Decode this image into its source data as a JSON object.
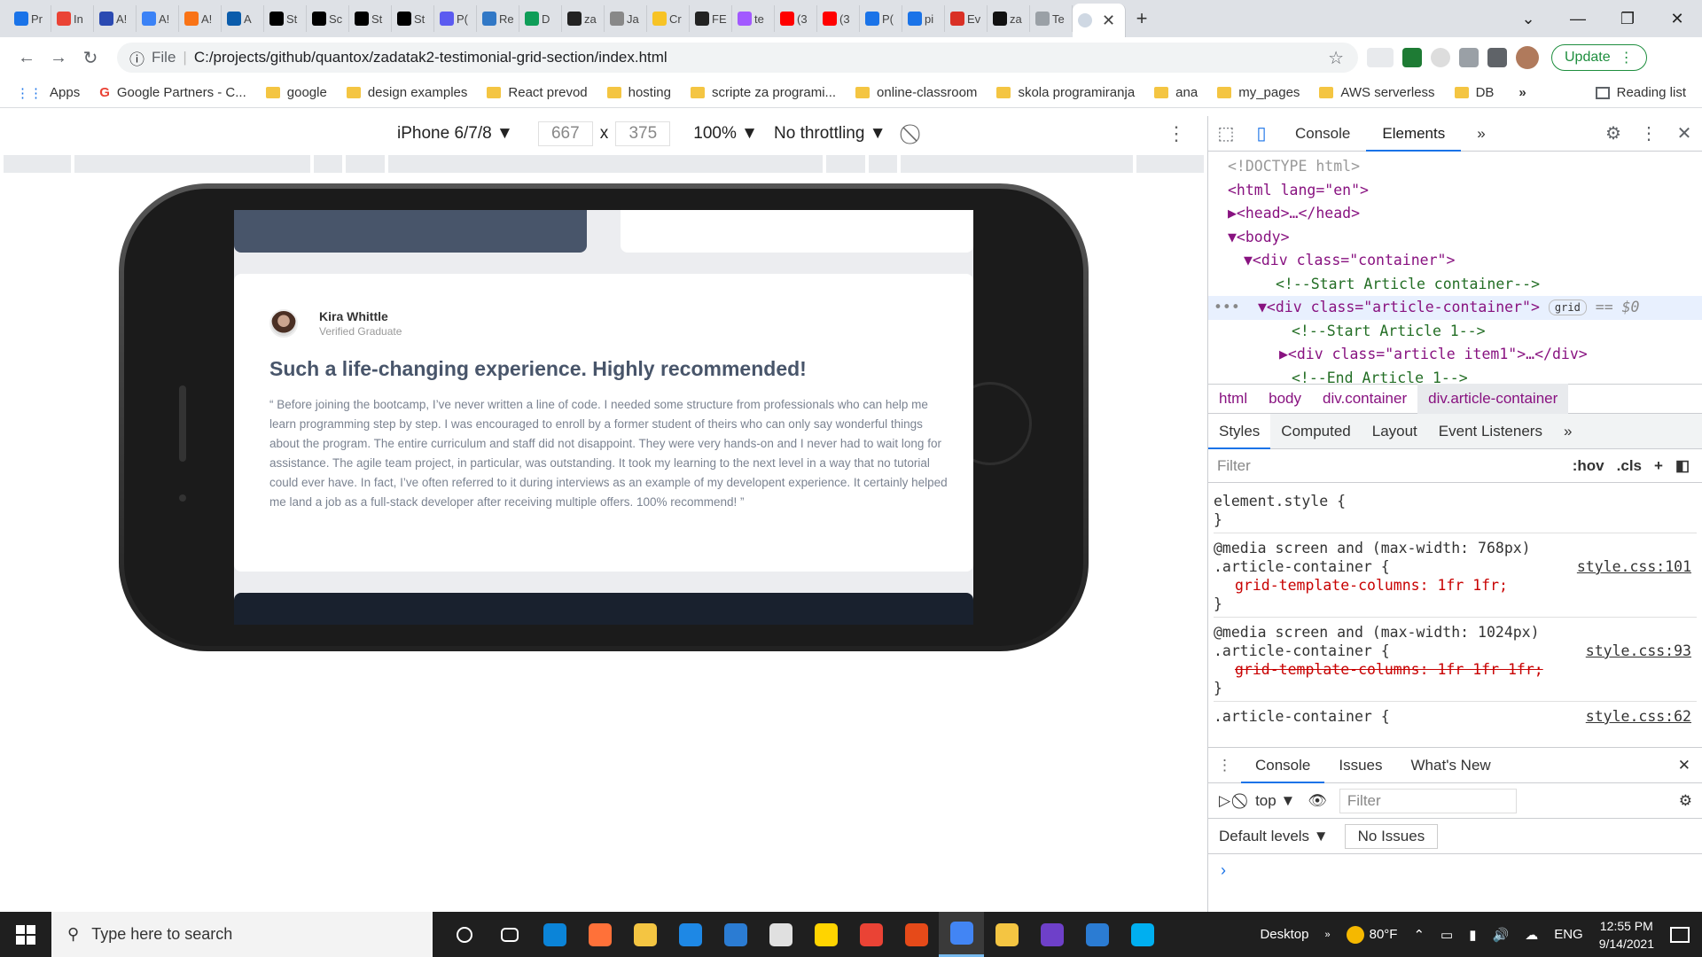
{
  "browser": {
    "tabs": [
      {
        "label": "Pr",
        "color": "#1a73e8"
      },
      {
        "label": "In",
        "color": "#ea4335"
      },
      {
        "label": "A!",
        "color": "#2b4ab2"
      },
      {
        "label": "A!",
        "color": "#3b82f6"
      },
      {
        "label": "A!",
        "color": "#f97316"
      },
      {
        "label": "A",
        "color": "#0b5cab"
      },
      {
        "label": "St",
        "color": "#000000"
      },
      {
        "label": "Sc",
        "color": "#000000"
      },
      {
        "label": "St",
        "color": "#000000"
      },
      {
        "label": "St",
        "color": "#000000"
      },
      {
        "label": "P(",
        "color": "#5b5bf0"
      },
      {
        "label": "Re",
        "color": "#3178c6"
      },
      {
        "label": "D",
        "color": "#0f9d58"
      },
      {
        "label": "za",
        "color": "#222222"
      },
      {
        "label": "Ja",
        "color": "#888888"
      },
      {
        "label": "Cr",
        "color": "#f7c325"
      },
      {
        "label": "FE",
        "color": "#222222"
      },
      {
        "label": "te",
        "color": "#a259ff"
      },
      {
        "label": "(3",
        "color": "#ff0000"
      },
      {
        "label": "(3",
        "color": "#ff0000"
      },
      {
        "label": "P(",
        "color": "#1a73e8"
      },
      {
        "label": "pi",
        "color": "#1a73e8"
      },
      {
        "label": "Ev",
        "color": "#d93025"
      },
      {
        "label": "za",
        "color": "#111111"
      },
      {
        "label": "Te",
        "color": "#9aa0a6"
      }
    ],
    "active_tab_icon": "globe-icon",
    "url_prefix": "File",
    "url": "C:/projects/github/quantox/zadatak2-testimonial-grid-section/index.html",
    "update_label": "Update"
  },
  "bookmarks": {
    "items": [
      {
        "label": "Apps",
        "kind": "apps"
      },
      {
        "label": "Google Partners - C...",
        "kind": "google"
      },
      {
        "label": "google",
        "kind": "folder"
      },
      {
        "label": "design examples",
        "kind": "folder"
      },
      {
        "label": "React prevod",
        "kind": "folder"
      },
      {
        "label": "hosting",
        "kind": "folder"
      },
      {
        "label": "scripte za programi...",
        "kind": "folder"
      },
      {
        "label": "online-classroom",
        "kind": "folder"
      },
      {
        "label": "skola programiranja",
        "kind": "folder"
      },
      {
        "label": "ana",
        "kind": "folder"
      },
      {
        "label": "my_pages",
        "kind": "folder"
      },
      {
        "label": "AWS serverless",
        "kind": "folder"
      },
      {
        "label": "DB",
        "kind": "folder"
      }
    ],
    "more": "»",
    "reading_list": "Reading list"
  },
  "device_toolbar": {
    "device": "iPhone 6/7/8",
    "width": "667",
    "height": "375",
    "zoom": "100%",
    "throttle": "No throttling"
  },
  "page": {
    "author_name": "Kira Whittle",
    "author_role": "Verified Graduate",
    "title": "Such a life-changing experience. Highly recommended!",
    "quote": "“ Before joining the bootcamp, I’ve never written a line of code. I needed some structure from professionals who can help me learn programming step by step. I was encouraged to enroll by a former student of theirs who can only say wonderful things about the program. The entire curriculum and staff did not disappoint. They were very hands-on and I never had to wait long for assistance. The agile team project, in particular, was outstanding. It took my learning to the next level in a way that no tutorial could ever have. In fact, I’ve often referred to it during interviews as an example of my developent experience. It certainly helped me land a job as a full-stack developer after receiving multiple offers. 100% recommend! ”"
  },
  "devtools": {
    "tabs": [
      "Console",
      "Elements",
      "»"
    ],
    "active_tab": "Elements",
    "dom": [
      "<!DOCTYPE html>",
      "<html lang=\"en\">",
      "▶<head>…</head>",
      "▼<body>",
      "▼<div class=\"container\">",
      "<!--Start Article container-->",
      "▼<div class=\"article-container\">",
      "<!--Start Article 1-->",
      "▶<div class=\"article item1\">…</div>",
      "<!--End Article 1-->"
    ],
    "grid_badge": "grid",
    "selected_marker": "== $0",
    "breadcrumbs": [
      "html",
      "body",
      "div.container",
      "div.article-container"
    ],
    "style_tabs": [
      "Styles",
      "Computed",
      "Layout",
      "Event Listeners",
      "»"
    ],
    "filter_placeholder": "Filter",
    "hov": ":hov",
    "cls": ".cls",
    "styles": [
      {
        "selector": "element.style {",
        "close": "}"
      },
      {
        "media": "@media screen and (max-width: 768px)",
        "selector": ".article-container {",
        "prop": "grid-template-columns: 1fr 1fr;",
        "source": "style.css:101",
        "close": "}",
        "struck": false
      },
      {
        "media": "@media screen and (max-width: 1024px)",
        "selector": ".article-container {",
        "prop": "grid-template-columns: 1fr 1fr 1fr;",
        "source": "style.css:93",
        "close": "}",
        "struck": true
      },
      {
        "selector": ".article-container {",
        "source": "style.css:62"
      }
    ],
    "drawer_tabs": [
      "Console",
      "Issues",
      "What's New"
    ],
    "context": "top",
    "console_filter": "Filter",
    "levels": "Default levels ▼",
    "no_issues": "No Issues",
    "prompt": "›"
  },
  "taskbar": {
    "search_placeholder": "Type here to search",
    "apps": [
      {
        "name": "cortana",
        "color": "#1f1f1f"
      },
      {
        "name": "task-view",
        "color": "#1f1f1f"
      },
      {
        "name": "edge",
        "color": "#0b84d8"
      },
      {
        "name": "firefox",
        "color": "#ff7139"
      },
      {
        "name": "file-explorer",
        "color": "#f4c542"
      },
      {
        "name": "vscode",
        "color": "#1e88e5"
      },
      {
        "name": "mail",
        "color": "#2b7cd3"
      },
      {
        "name": "paint",
        "color": "#e0e0e0"
      },
      {
        "name": "sticky-notes",
        "color": "#ffd400"
      },
      {
        "name": "gmail",
        "color": "#ea4335"
      },
      {
        "name": "office",
        "color": "#e64a19"
      },
      {
        "name": "chrome",
        "color": "#4285f4"
      },
      {
        "name": "notepad",
        "color": "#f4c542"
      },
      {
        "name": "github-desktop",
        "color": "#6e40c9"
      },
      {
        "name": "photos",
        "color": "#2b7cd3"
      },
      {
        "name": "skype",
        "color": "#00aff0"
      }
    ],
    "desktop_label": "Desktop",
    "weather": "80°F",
    "lang": "ENG",
    "time": "12:55 PM",
    "date": "9/14/2021"
  }
}
